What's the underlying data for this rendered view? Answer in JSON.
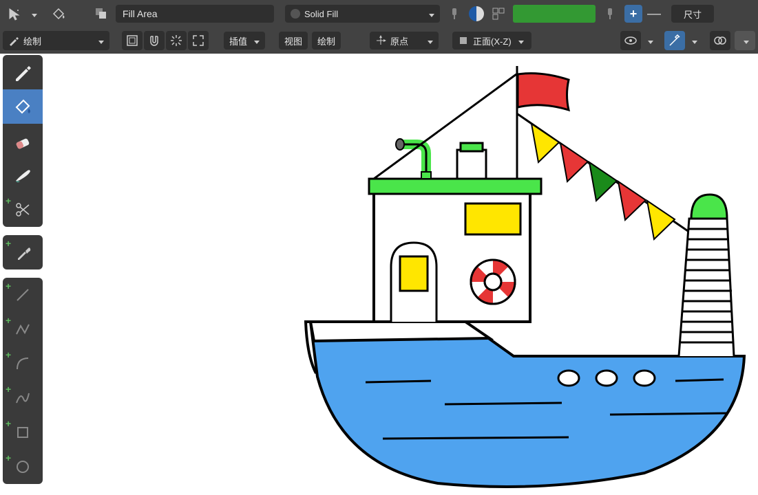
{
  "topbar": {
    "fill_area_label": "Fill Area",
    "fill_type_label": "Solid Fill",
    "color_swatch": "#339933",
    "size_label": "尺寸"
  },
  "secondbar": {
    "mode_label": "绘制",
    "interp_label": "插值",
    "view_label": "视图",
    "draw_label": "绘制",
    "origin_label": "原点",
    "orientation_label": "正面(X-Z)"
  },
  "tools": [
    {
      "name": "pencil",
      "active": false
    },
    {
      "name": "fill",
      "active": true
    },
    {
      "name": "eraser",
      "active": false
    },
    {
      "name": "brush",
      "active": false
    },
    {
      "name": "cutter",
      "active": false
    },
    {
      "name": "eyedropper",
      "active": false
    },
    {
      "name": "line",
      "active": false
    },
    {
      "name": "polyline",
      "active": false
    },
    {
      "name": "arc",
      "active": false
    },
    {
      "name": "curve",
      "active": false
    },
    {
      "name": "box",
      "active": false
    },
    {
      "name": "circle",
      "active": false
    }
  ]
}
